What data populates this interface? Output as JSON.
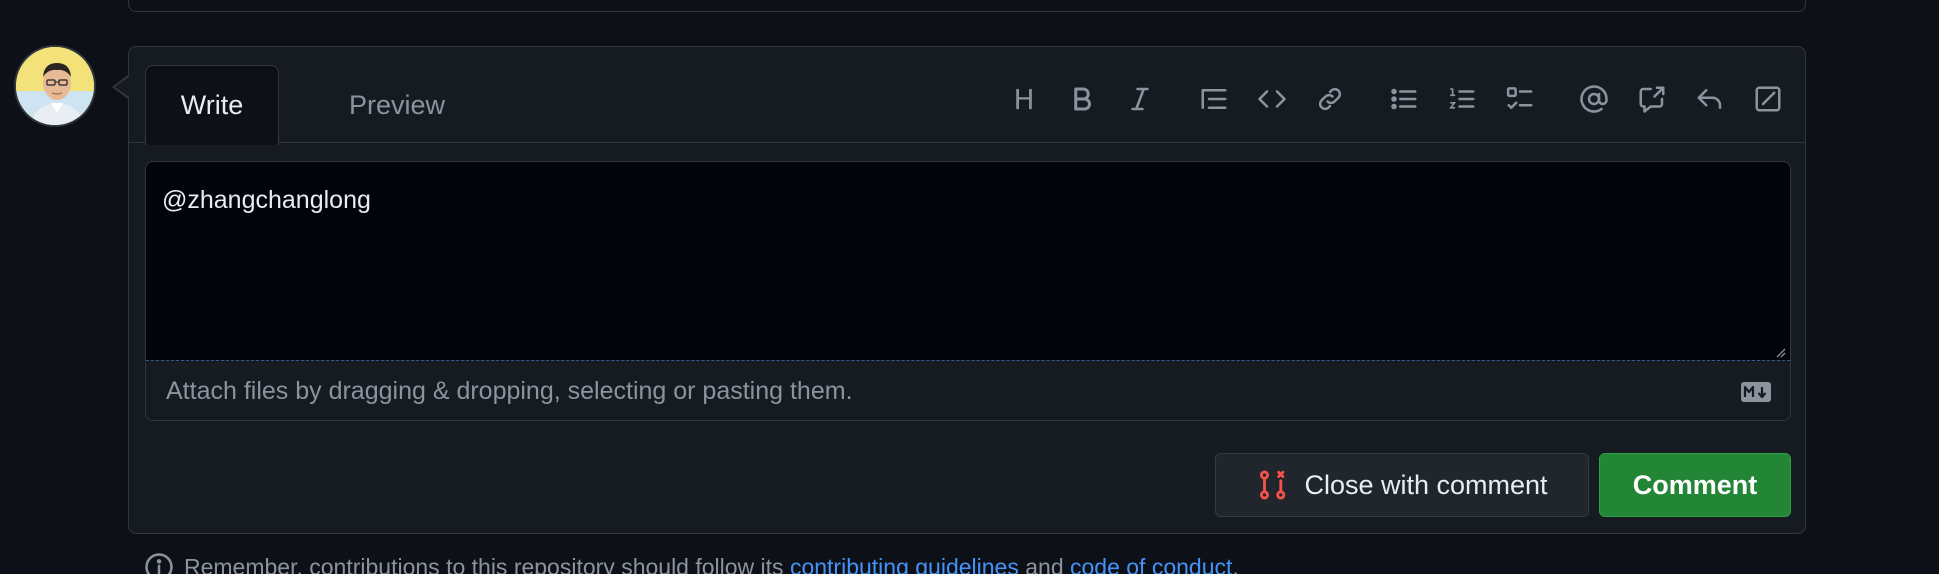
{
  "tabs": {
    "write": "Write",
    "preview": "Preview"
  },
  "toolbar": {
    "items": [
      {
        "name": "heading",
        "icon": "heading-icon",
        "text": "H"
      },
      {
        "name": "bold",
        "icon": "bold-icon"
      },
      {
        "name": "italic",
        "icon": "italic-icon"
      },
      {
        "name": "quote",
        "icon": "quote-icon"
      },
      {
        "name": "code",
        "icon": "code-icon"
      },
      {
        "name": "link",
        "icon": "link-icon"
      },
      {
        "name": "unordered-list",
        "icon": "list-unordered-icon"
      },
      {
        "name": "ordered-list",
        "icon": "list-ordered-icon"
      },
      {
        "name": "task-list",
        "icon": "tasklist-icon"
      },
      {
        "name": "mention",
        "icon": "mention-icon"
      },
      {
        "name": "reference",
        "icon": "cross-reference-icon"
      },
      {
        "name": "saved-replies",
        "icon": "reply-icon"
      },
      {
        "name": "fullscreen",
        "icon": "edit-fullscreen-icon"
      }
    ]
  },
  "editor": {
    "value": "@zhangchanglong",
    "attach_text": "Attach files by dragging & dropping, selecting or pasting them."
  },
  "actions": {
    "close_with_comment": "Close with comment",
    "comment": "Comment"
  },
  "note": {
    "prefix": "Remember, contributions to this repository should follow its",
    "link1": "contributing guidelines",
    "middle": "and",
    "link2": "code of conduct",
    "suffix": "."
  },
  "colors": {
    "background": "#0d1117",
    "panel": "#161b22",
    "border": "#30363d",
    "accent_green": "#238636",
    "link_blue": "#4493f8",
    "danger_red": "#f85149"
  }
}
